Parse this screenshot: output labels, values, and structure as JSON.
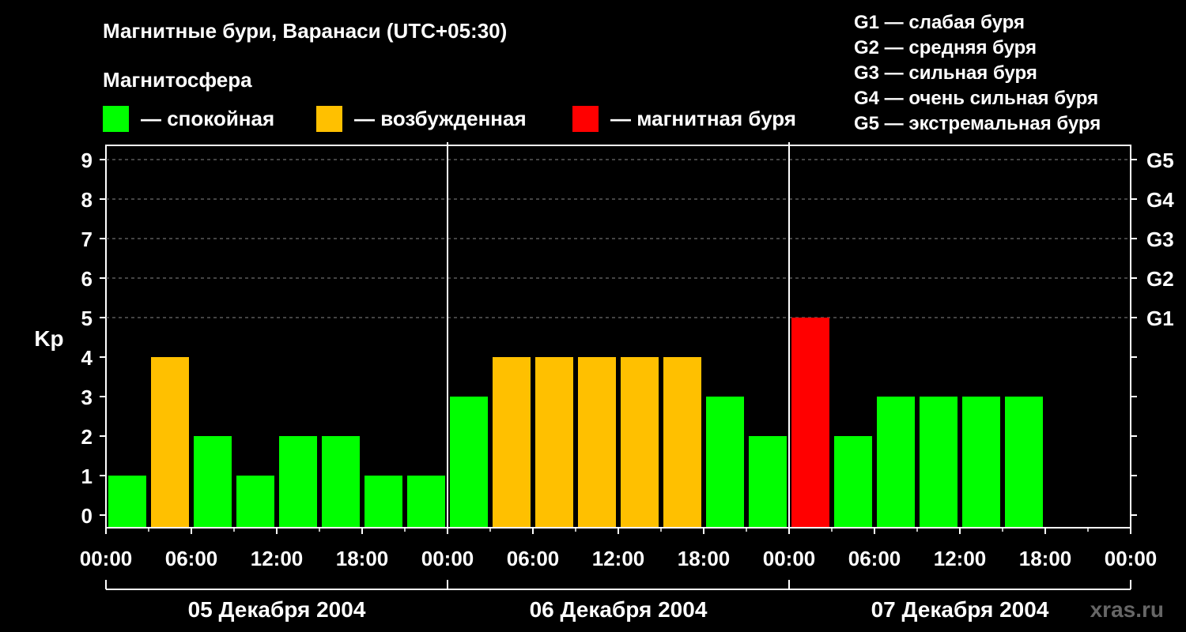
{
  "title": "Магнитные бури, Варанаси (UTC+05:30)",
  "legend": {
    "heading": "Магнитосфера",
    "items": [
      {
        "label": "— спокойная",
        "color": "#00ff00"
      },
      {
        "label": "— возбужденная",
        "color": "#ffc000"
      },
      {
        "label": "— магнитная буря",
        "color": "#ff0000"
      }
    ]
  },
  "storm_scale": [
    "G1 — слабая буря",
    "G2 — средняя буря",
    "G3 — сильная буря",
    "G4 — очень сильная буря",
    "G5 — экстремальная буря"
  ],
  "watermark": "xras.ru",
  "chart_data": {
    "type": "bar",
    "ylabel": "Kp",
    "ylim": [
      0,
      9
    ],
    "y_ticks": [
      "0",
      "1",
      "2",
      "3",
      "4",
      "5",
      "6",
      "7",
      "8",
      "9"
    ],
    "right_ticks": [
      {
        "value": 5,
        "label": "G1"
      },
      {
        "value": 6,
        "label": "G2"
      },
      {
        "value": 7,
        "label": "G3"
      },
      {
        "value": 8,
        "label": "G4"
      },
      {
        "value": 9,
        "label": "G5"
      }
    ],
    "x_ticks": [
      "00:00",
      "06:00",
      "12:00",
      "18:00",
      "00:00",
      "06:00",
      "12:00",
      "18:00",
      "00:00",
      "06:00",
      "12:00",
      "18:00",
      "00:00"
    ],
    "days": [
      "05 Декабря 2004",
      "06 Декабря 2004",
      "07 Декабря 2004"
    ],
    "interval_hours": 3,
    "start_hour": 1.5,
    "values": [
      1,
      4,
      2,
      1,
      2,
      2,
      1,
      1,
      3,
      4,
      4,
      4,
      4,
      4,
      3,
      2,
      5,
      2,
      3,
      3,
      3,
      3
    ],
    "colors": {
      "quiet": "#00ff00",
      "active": "#ffc000",
      "storm": "#ff0000"
    },
    "grid": true,
    "legend_position": "top"
  }
}
